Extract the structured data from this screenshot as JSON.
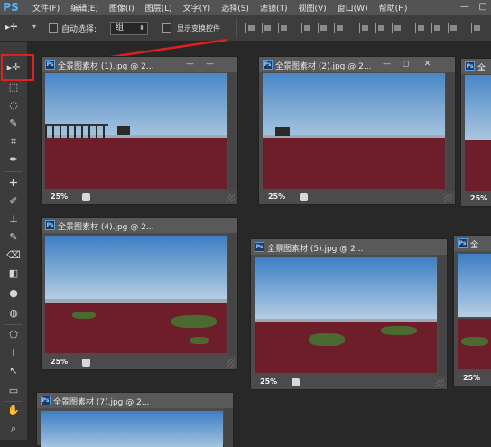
{
  "app": {
    "logo": "PS"
  },
  "menu": [
    "文件(F)",
    "编辑(E)",
    "图像(I)",
    "图层(L)",
    "文字(Y)",
    "选择(S)",
    "滤镜(T)",
    "视图(V)",
    "窗口(W)",
    "帮助(H)"
  ],
  "window_controls": {
    "minimize": "—",
    "maximize": "▢"
  },
  "options": {
    "move_tool_icon": "▸✛",
    "move_tool_arrow": "▾",
    "auto_select_label": "自动选择:",
    "auto_select_value": "组",
    "show_transform_label": "显示变换控件"
  },
  "tools": [
    "▸✛",
    "⬚",
    "◌",
    "✎",
    "⌗",
    "✒",
    "✚",
    "✐",
    "⊥",
    "✎",
    "⌫",
    "◧",
    "●",
    "◍",
    "⬠",
    "T",
    "↖",
    "▭",
    "✋",
    "⌕"
  ],
  "documents": [
    {
      "name": "全景图素材 (1).jpg @ 2...",
      "zoom": "25%",
      "green": false
    },
    {
      "name": "全景图素材 (2).jpg @ 2...",
      "zoom": "25%",
      "green": false
    },
    {
      "name": "全景图素材 (4).jpg @ 2...",
      "zoom": "25%",
      "green": true
    },
    {
      "name": "全景图素材 (5).jpg @ 2...",
      "zoom": "25%",
      "green": true
    },
    {
      "name": "全景图素材 (7).jpg @ 2...",
      "zoom": "",
      "green": false
    },
    {
      "name": "全",
      "zoom": "25%",
      "green": true
    },
    {
      "name": "全",
      "zoom": "25%",
      "green": false
    }
  ],
  "doc_buttons": {
    "minimize": "—",
    "maximize": "◻",
    "close": "✕"
  },
  "badge": "Ps",
  "annotation": {
    "color": "#e02020"
  }
}
